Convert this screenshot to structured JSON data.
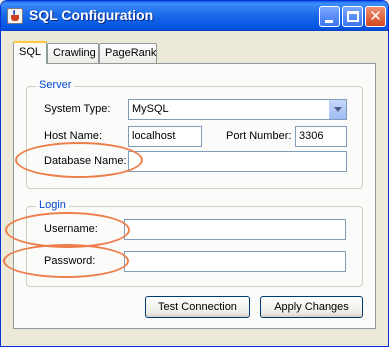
{
  "window": {
    "title": "SQL Configuration",
    "accent_color": "#0a5ee8",
    "controls": [
      "minimize-icon",
      "maximize-icon",
      "close-icon"
    ]
  },
  "tabs": [
    {
      "label": "SQL",
      "active": true
    },
    {
      "label": "Crawling",
      "active": false
    },
    {
      "label": "PageRank",
      "active": false
    }
  ],
  "server": {
    "title": "Server",
    "system_type_label": "System Type:",
    "system_type_value": "MySQL",
    "host_name_label": "Host Name:",
    "host_name_value": "localhost",
    "port_number_label": "Port Number:",
    "port_number_value": "3306",
    "database_name_label": "Database Name:",
    "database_name_value": ""
  },
  "login": {
    "title": "Login",
    "username_label": "Username:",
    "username_value": "",
    "password_label": "Password:",
    "password_value": ""
  },
  "buttons": {
    "test_connection": "Test Connection",
    "apply_changes": "Apply Changes"
  },
  "highlight_color": "#ed7d4a"
}
